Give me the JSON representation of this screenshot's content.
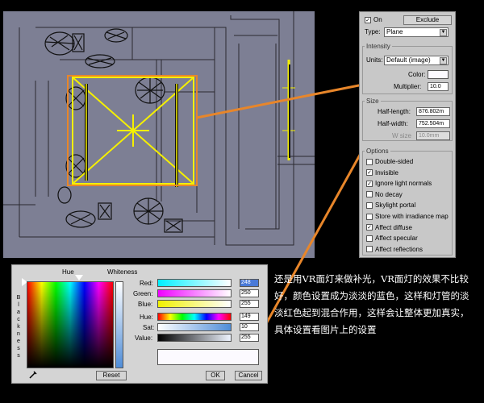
{
  "panel": {
    "on_label": "On",
    "exclude_label": "Exclude",
    "type_label": "Type:",
    "type_value": "Plane",
    "intensity_title": "Intensity",
    "units_label": "Units:",
    "units_value": "Default (image)",
    "color_label": "Color:",
    "color_value": "#fcfaff",
    "multiplier_label": "Multiplier:",
    "multiplier_value": "10.0",
    "size_title": "Size",
    "half_length_label": "Half-length:",
    "half_length_value": "876.802m",
    "half_width_label": "Half-width:",
    "half_width_value": "752.504m",
    "w_size_label": "W size",
    "w_size_value": "10.0mm",
    "options_title": "Options",
    "options": [
      {
        "label": "Double-sided",
        "checked": false
      },
      {
        "label": "Invisible",
        "checked": true
      },
      {
        "label": "Ignore light normals",
        "checked": true
      },
      {
        "label": "No decay",
        "checked": false
      },
      {
        "label": "Skylight portal",
        "checked": false
      },
      {
        "label": "Store with irradiance map",
        "checked": false
      },
      {
        "label": "Affect diffuse",
        "checked": true
      },
      {
        "label": "Affect specular",
        "checked": false
      },
      {
        "label": "Affect reflections",
        "checked": false
      }
    ]
  },
  "picker": {
    "hue_label": "Hue",
    "whiteness_label": "Whiteness",
    "blackness_label": "Blackness",
    "red_label": "Red:",
    "red_value": "248",
    "green_label": "Green:",
    "green_value": "250",
    "blue_label": "Blue:",
    "blue_value": "255",
    "hue_row_label": "Hue:",
    "hue_value": "149",
    "sat_label": "Sat:",
    "sat_value": "10",
    "value_label": "Value:",
    "value_value": "255",
    "reset_label": "Reset",
    "ok_label": "OK",
    "cancel_label": "Cancel"
  },
  "caption": "还是用VR面灯来做补光，VR面灯的效果不比较好，颜色设置成为淡淡的蓝色，这样和灯管的淡淡红色起到混合作用，这样会让整体更加真实，具体设置看图片上的设置",
  "colors": {
    "accent_line": "#e8862a",
    "light_yellow": "#f5f000",
    "viewport_bg": "#7d7f94"
  }
}
